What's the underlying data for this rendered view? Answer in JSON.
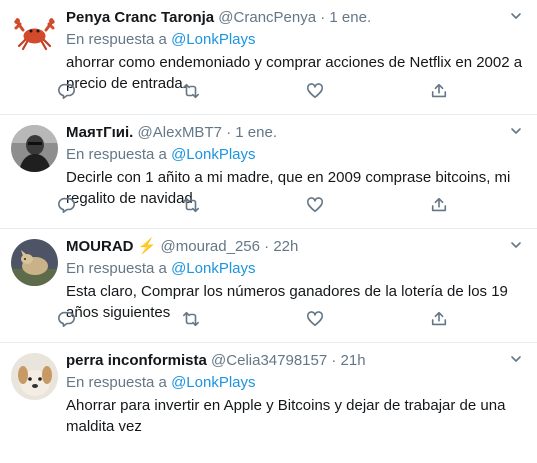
{
  "reply_label": "En respuesta a",
  "tweets": [
    {
      "name": "Penya Cranc Taronja",
      "handle": "@CrancPenya",
      "separator": "·",
      "time": "1 ene.",
      "mention": "@LonkPlays",
      "text": "ahorrar como endemoniado y comprar acciones de Netflix en 2002 a precio de entrada.",
      "avatar_icon": "crab-icon"
    },
    {
      "name": "МаятГıиі.",
      "handle": "@AlexMBT7",
      "separator": "·",
      "time": "1 ene.",
      "mention": "@LonkPlays",
      "text": "Decirle con 1 añito a mi madre, que en 2009 comprase bitcoins, mi regalito de navidad",
      "avatar_icon": "person-photo-icon"
    },
    {
      "name": "MOURAD",
      "name_emoji": "⚡",
      "handle": "@mourad_256",
      "separator": "·",
      "time": "22h",
      "mention": "@LonkPlays",
      "text": "Esta claro, Comprar los números ganadores de la lotería de los 19 años siguientes",
      "avatar_icon": "animal-photo-icon"
    },
    {
      "name": "perra inconformista",
      "handle": "@Celia34798157",
      "separator": "·",
      "time": "21h",
      "mention": "@LonkPlays",
      "text": "Ahorrar para invertir en Apple y Bitcoins y dejar de trabajar de una maldita vez",
      "avatar_icon": "dog-photo-icon"
    }
  ],
  "colors": {
    "text": "#14171a",
    "secondary": "#657786",
    "link": "#1b95e0",
    "border": "#e6ecf0",
    "lightning": "#ffac33"
  }
}
